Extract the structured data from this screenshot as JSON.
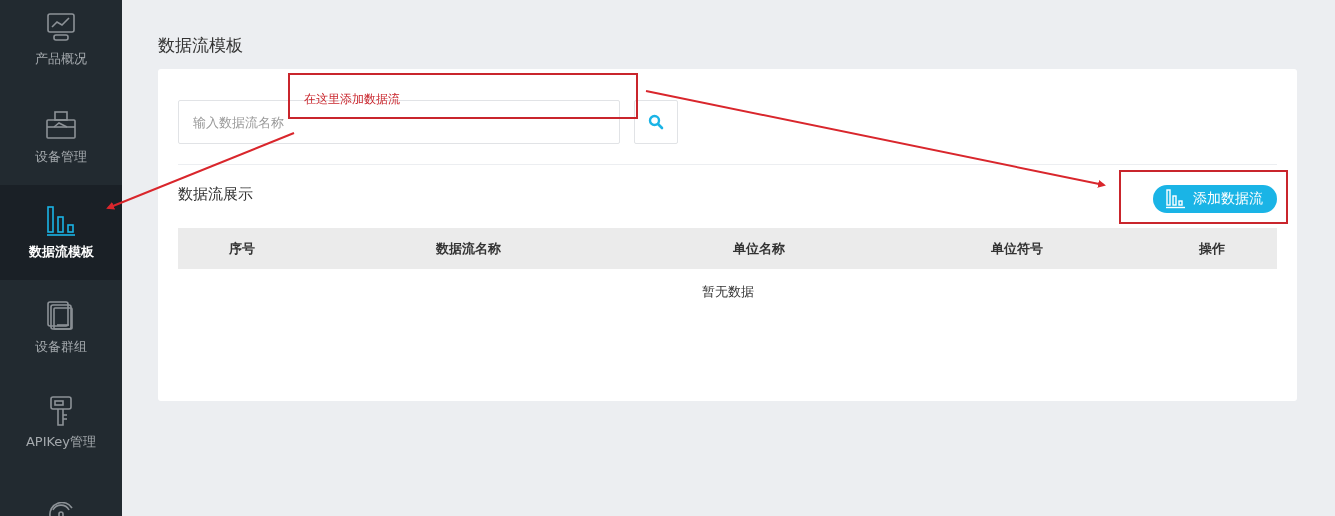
{
  "sidebar": {
    "items": [
      {
        "label": "产品概况",
        "selected": false
      },
      {
        "label": "设备管理",
        "selected": false
      },
      {
        "label": "数据流模板",
        "selected": true
      },
      {
        "label": "设备群组",
        "selected": false
      },
      {
        "label": "APIKey管理",
        "selected": false
      },
      {
        "selected": false
      }
    ]
  },
  "page_title": "数据流模板",
  "search": {
    "placeholder": "输入数据流名称"
  },
  "section_title": "数据流展示",
  "add_button": {
    "label": "添加数据流"
  },
  "table": {
    "columns": [
      "序号",
      "数据流名称",
      "单位名称",
      "单位符号",
      "操作"
    ],
    "empty_text": "暂无数据"
  },
  "annotation": {
    "text": "在这里添加数据流"
  }
}
